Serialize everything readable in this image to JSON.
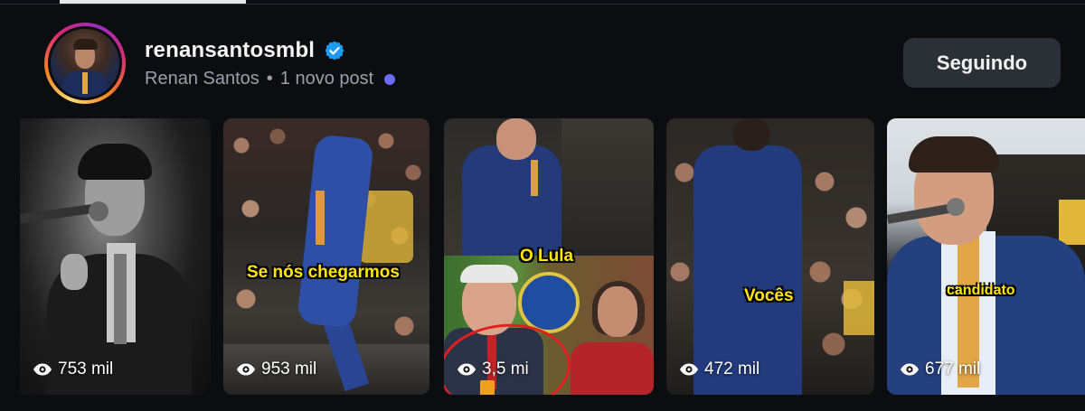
{
  "profile": {
    "username": "renansantosmbl",
    "display_name": "Renan Santos",
    "separator": "•",
    "new_posts": "1 novo post",
    "follow_button": "Seguindo",
    "verified_icon": "verified-badge-icon",
    "new_indicator_color": "#6a6cf5"
  },
  "reels": [
    {
      "views": "753 mil",
      "caption": ""
    },
    {
      "views": "953 mil",
      "caption": "Se nós chegarmos"
    },
    {
      "views": "3,5 mi",
      "caption": "O Lula"
    },
    {
      "views": "472 mil",
      "caption": "Vocês"
    },
    {
      "views": "677 mil",
      "caption": "candidato"
    }
  ],
  "colors": {
    "background": "#0b0d11",
    "verified": "#1d9bf0",
    "caption": "#ffe600",
    "annotation": "#e02020"
  }
}
